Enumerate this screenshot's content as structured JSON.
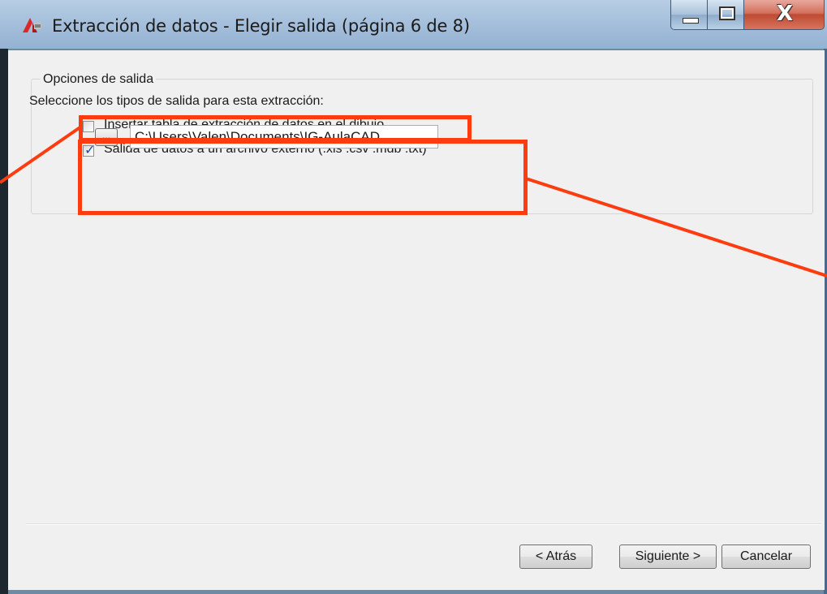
{
  "window": {
    "title": "Extracción de datos - Elegir salida (página 6 de 8)",
    "close_glyph": "X"
  },
  "output_options": {
    "group_title": "Opciones de salida",
    "instruction": "Seleccione los tipos de salida para esta extracción:",
    "insert_table": {
      "label": "Insertar tabla de extracción de datos en el dibujo",
      "checked": false
    },
    "external_file": {
      "label": "Salida de datos a un archivo externo (.xls .csv .mdb .txt)",
      "checked": true
    },
    "browse_label": "...",
    "file_path": "C:\\Users\\Valen\\Documents\\IG-AulaCAD"
  },
  "footer": {
    "back_label": "< Atrás",
    "next_label": "Siguiente >",
    "cancel_label": "Cancelar"
  },
  "icons": {
    "app": "autocad-icon",
    "minimize": "minimize-icon",
    "maximize": "maximize-icon",
    "close": "close-icon",
    "check": "checkmark-icon"
  },
  "colors": {
    "annotation": "#ff3b10",
    "checkmark": "#1c4c9c",
    "dialog_bg": "#f0f0f0",
    "titlebar": "#a6c0dc"
  }
}
